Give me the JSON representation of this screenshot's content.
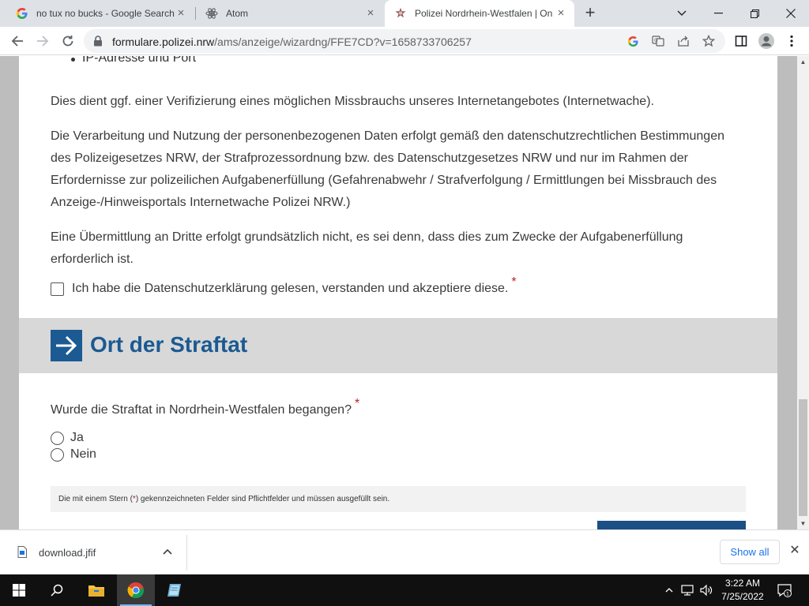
{
  "browser": {
    "tabs": [
      {
        "title": "no tux no bucks - Google Search",
        "icon": "google-icon"
      },
      {
        "title": "Atom",
        "icon": "atom-icon"
      },
      {
        "title": "Polizei Nordrhein-Westfalen | On",
        "icon": "police-star-icon",
        "active": true
      }
    ],
    "new_tab_label": "+",
    "url_host": "formulare.polizei.nrw",
    "url_path": "/ams/anzeige/wizardng/FFE7CD?v=1658733706257"
  },
  "page": {
    "bullet_item": "IP-Adresse und Port",
    "paragraph1": "Dies dient ggf. einer Verifizierung eines möglichen Missbrauchs unseres Internetangebotes (Internetwache).",
    "paragraph2": "Die Verarbeitung und Nutzung der personenbezogenen Daten erfolgt gemäß den datenschutzrechtlichen Bestimmungen des Polizeigesetzes NRW, der Strafprozessordnung bzw. des Datenschutzgesetzes NRW und nur im Rahmen der Erfordernisse zur polizeilichen Aufgabenerfüllung (Gefahrenabwehr / Strafverfolgung / Ermittlungen bei Missbrauch des Anzeige-/Hinweisportals Internetwache Polizei NRW.)",
    "paragraph3": "Eine Übermittlung an Dritte erfolgt grundsätzlich nicht, es sei denn, dass dies zum Zwecke der Aufgabenerfüllung erforderlich ist.",
    "consent_label": "Ich habe die Datenschutzerklärung gelesen, verstanden und akzeptiere diese.",
    "required_mark": "*",
    "section_title": "Ort der Straftat",
    "question": "Wurde die Straftat in Nordrhein-Westfalen begangen?",
    "options": [
      "Ja",
      "Nein"
    ],
    "note_prefix": "Die mit einem Stern (",
    "note_star": "*",
    "note_suffix": ") gekennzeichneten Felder sind Pflichtfelder und müssen ausgefüllt sein.",
    "accent_color": "#1b5a92",
    "required_color": "#b3262b"
  },
  "downloads": {
    "file_name": "download.jfif",
    "show_all": "Show all"
  },
  "taskbar": {
    "time": "3:22 AM",
    "date": "7/25/2022",
    "notification_count": "1"
  }
}
